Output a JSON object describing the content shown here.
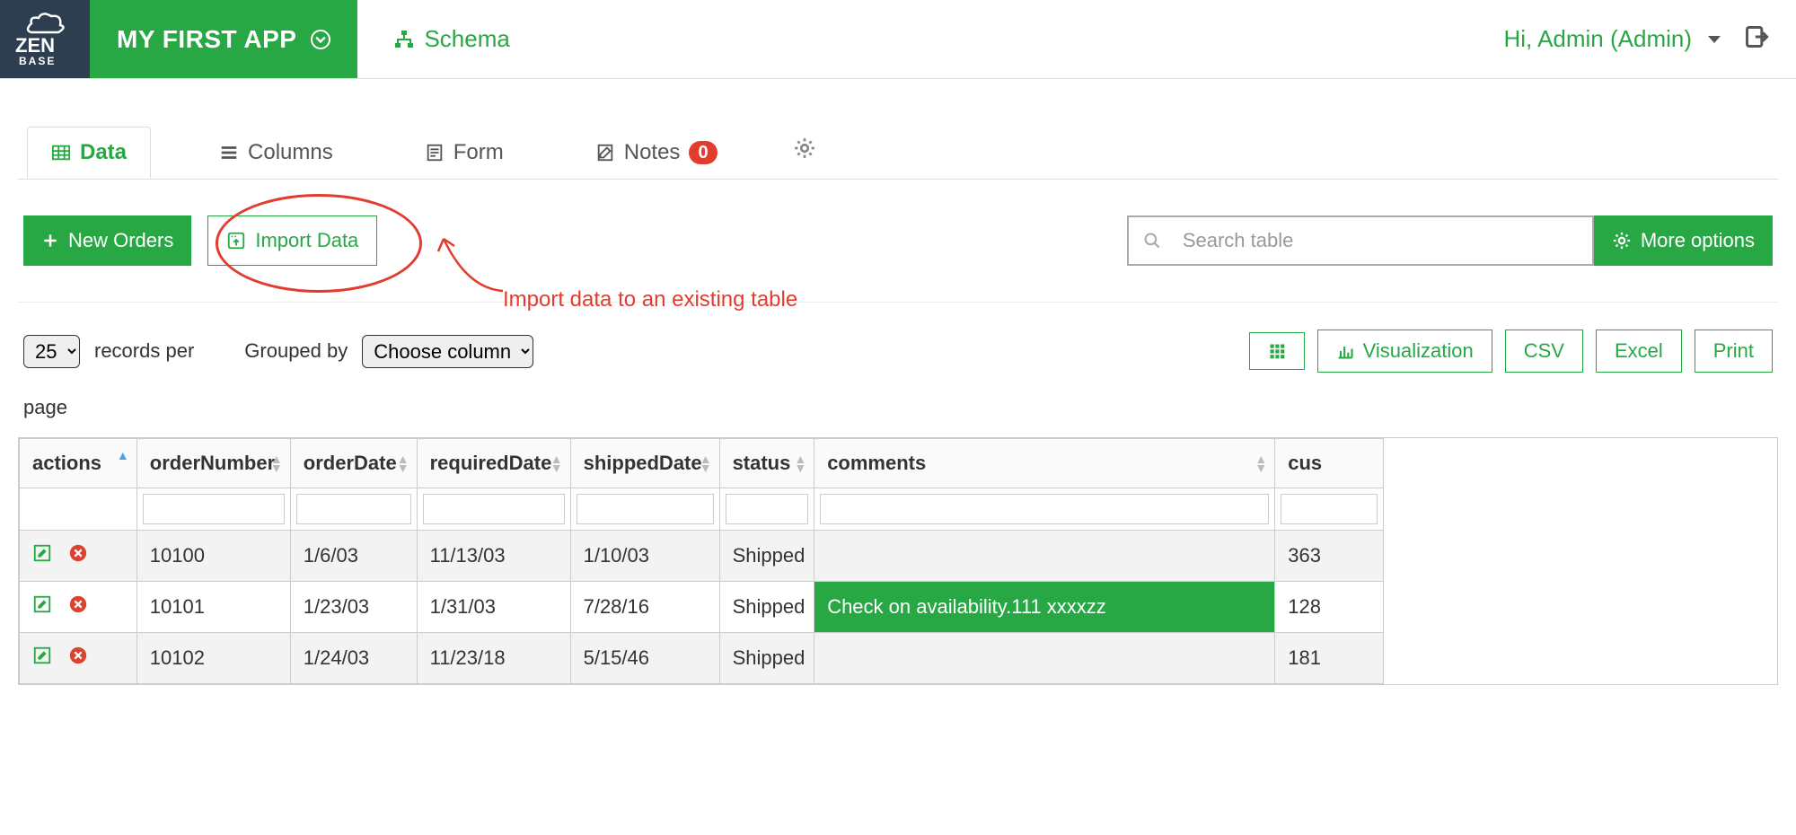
{
  "nav": {
    "app_name": "MY FIRST APP",
    "schema_label": "Schema",
    "greeting": "Hi, Admin (Admin)"
  },
  "tabs": {
    "data": "Data",
    "columns": "Columns",
    "form": "Form",
    "notes": "Notes",
    "notes_count": "0"
  },
  "toolbar": {
    "new_label": "New Orders",
    "import_label": "Import Data",
    "search_placeholder": "Search table",
    "more_label": "More options"
  },
  "annotation": {
    "text": "Import data to an existing table"
  },
  "controls": {
    "page_size": "25",
    "records_per_label": "records per",
    "page_label": "page",
    "grouped_by_label": "Grouped by",
    "grouped_by_value": "Choose column",
    "viz_label": "Visualization",
    "csv_label": "CSV",
    "excel_label": "Excel",
    "print_label": "Print"
  },
  "table": {
    "headers": {
      "actions": "actions",
      "orderNumber": "orderNumber",
      "orderDate": "orderDate",
      "requiredDate": "requiredDate",
      "shippedDate": "shippedDate",
      "status": "status",
      "comments": "comments",
      "customerNumber": "cus"
    },
    "rows": [
      {
        "orderNumber": "10100",
        "orderDate": "1/6/03",
        "requiredDate": "11/13/03",
        "shippedDate": "1/10/03",
        "status": "Shipped",
        "comments": "",
        "customerNumber": "363",
        "comments_highlight": false
      },
      {
        "orderNumber": "10101",
        "orderDate": "1/23/03",
        "requiredDate": "1/31/03",
        "shippedDate": "7/28/16",
        "status": "Shipped",
        "comments": "Check on availability.111 xxxxzz",
        "customerNumber": "128",
        "comments_highlight": true
      },
      {
        "orderNumber": "10102",
        "orderDate": "1/24/03",
        "requiredDate": "11/23/18",
        "shippedDate": "5/15/46",
        "status": "Shipped",
        "comments": "",
        "customerNumber": "181",
        "comments_highlight": false
      }
    ]
  }
}
